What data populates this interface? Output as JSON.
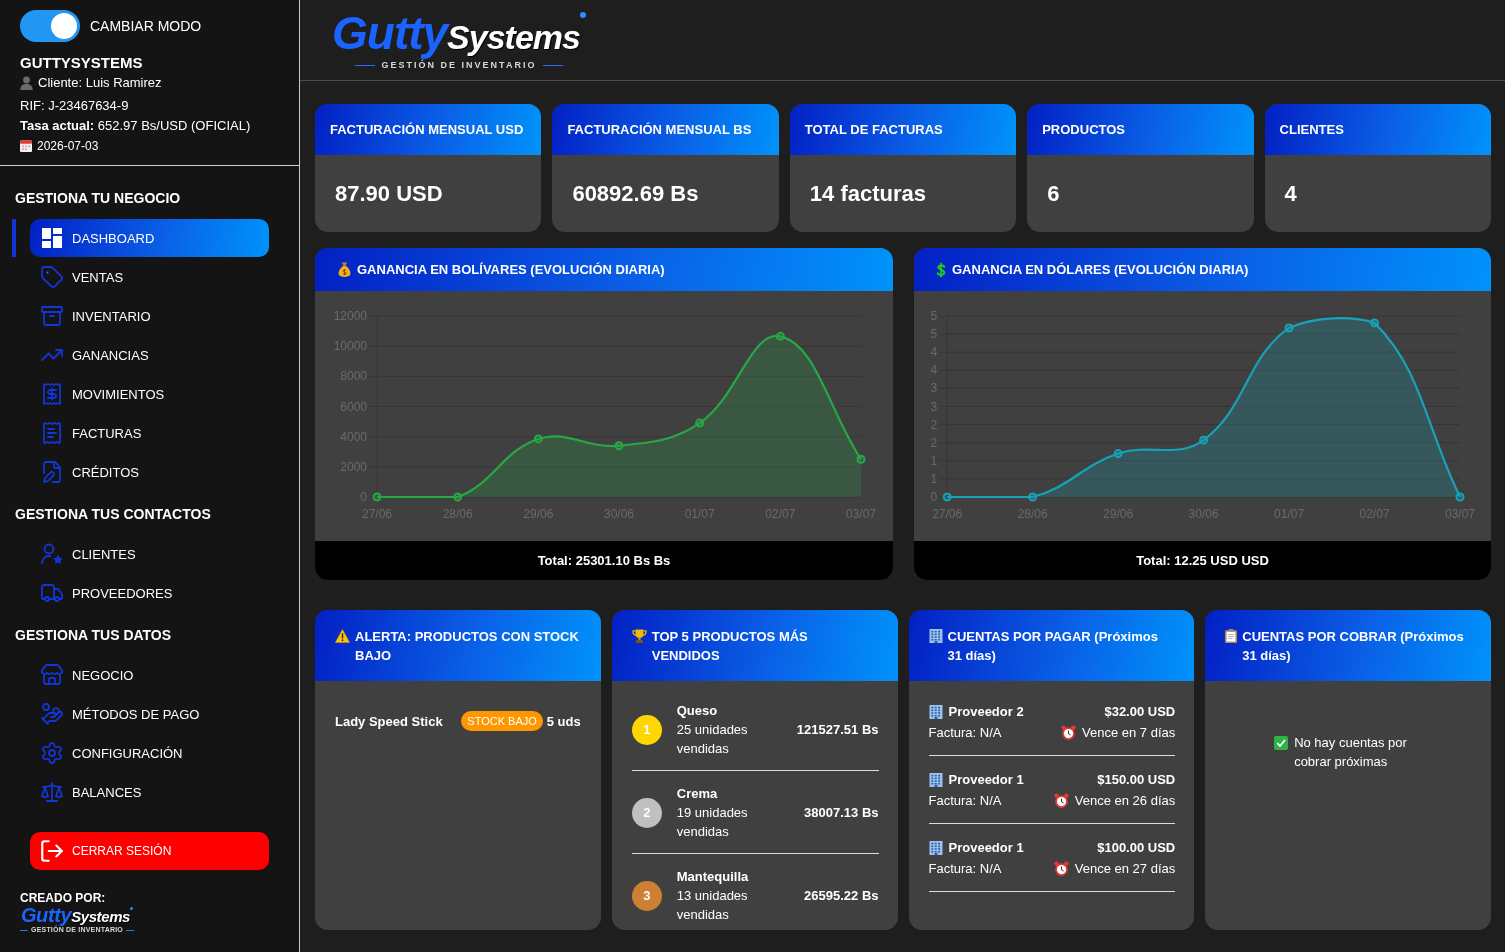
{
  "sidebar": {
    "mode_toggle": {
      "label": "CAMBIAR MODO",
      "on": true
    },
    "company": {
      "name": "GUTTYSYSTEMS",
      "client": "Cliente: Luis Ramirez",
      "rif": "RIF: J-23467634-9",
      "rate": "**Tasa actual:** 652.97 Bs/USD (OFICIAL)",
      "date": "2026-07-03"
    },
    "sections": [
      {
        "title": "GESTIONA TU NEGOCIO",
        "items": [
          {
            "label": "DASHBOARD",
            "selected": true
          },
          {
            "label": "VENTAS",
            "selected": false
          },
          {
            "label": "INVENTARIO",
            "selected": false
          },
          {
            "label": "GANANCIAS",
            "selected": false
          },
          {
            "label": "MOVIMIENTOS",
            "selected": false
          },
          {
            "label": "FACTURAS",
            "selected": false
          },
          {
            "label": "CRÉDITOS",
            "selected": false
          }
        ]
      },
      {
        "title": "GESTIONA TUS CONTACTOS",
        "items": [
          {
            "label": "CLIENTES",
            "selected": false
          },
          {
            "label": "PROVEEDORES",
            "selected": false
          }
        ]
      },
      {
        "title": "GESTIONA TUS DATOS",
        "items": [
          {
            "label": "NEGOCIO",
            "selected": false
          },
          {
            "label": "MÉTODOS DE PAGO",
            "selected": false
          },
          {
            "label": "CONFIGURACIÓN",
            "selected": false
          },
          {
            "label": "BALANCES",
            "selected": false
          }
        ]
      }
    ],
    "logout_button": "CERRAR SESIÓN",
    "footer": {
      "label": "CREADO POR:",
      "logo": {
        "name_parts": [
          "Gutty",
          "Systems"
        ],
        "tagline": "GESTIÓN DE INVENTARIO"
      }
    }
  },
  "header": {
    "logo": {
      "name_parts": [
        "Gutty",
        "Systems"
      ],
      "tagline": "GESTIÓN DE INVENTARIO"
    }
  },
  "stat_cards": [
    {
      "label": "FACTURACIÓN MENSUAL USD",
      "value": "87.90 USD"
    },
    {
      "label": "FACTURACIÓN MENSUAL BS",
      "value": "60892.69 Bs"
    },
    {
      "label": "TOTAL DE FACTURAS",
      "value": "14 facturas"
    },
    {
      "label": "PRODUCTOS",
      "value": "6"
    },
    {
      "label": "CLIENTES",
      "value": "4"
    }
  ],
  "chart_cards": [
    {
      "chart_data": {
        "type": "area",
        "title": "GANANCIA EN BOLÍVARES (EVOLUCIÓN DIARIA)",
        "categories": [
          "27/06",
          "28/06",
          "29/06",
          "30/06",
          "01/07",
          "02/07",
          "03/07"
        ],
        "series": [
          {
            "color": "#28a745",
            "values": [
              0,
              0,
              3850,
              3400,
              4900,
              10650,
              2500
            ]
          }
        ],
        "ylim": [
          0,
          12000
        ],
        "yticks": [
          0,
          2000,
          4000,
          6000,
          8000,
          10000,
          12000
        ],
        "grid": true
      },
      "total": "Total: 25301.10 Bs Bs"
    },
    {
      "chart_data": {
        "type": "area",
        "title": "GANANCIA EN DÓLARES (EVOLUCIÓN DIARIA)",
        "categories": [
          "27/06",
          "28/06",
          "29/06",
          "30/06",
          "01/07",
          "02/07",
          "03/07"
        ],
        "series": [
          {
            "color": "#17a2b8",
            "values": [
              0,
              0,
              1.2,
              1.57,
              4.67,
              4.81,
              0
            ]
          }
        ],
        "ylim": [
          0,
          5
        ],
        "yticks": [
          {
            "value": 0,
            "label": "0"
          },
          {
            "value": 0.5,
            "label": "1"
          },
          {
            "value": 1,
            "label": "1"
          },
          {
            "value": 1.5,
            "label": "2"
          },
          {
            "value": 2,
            "label": "2"
          },
          {
            "value": 2.5,
            "label": "3"
          },
          {
            "value": 3,
            "label": "3"
          },
          {
            "value": 3.5,
            "label": "4"
          },
          {
            "value": 4,
            "label": "4"
          },
          {
            "value": 4.5,
            "label": "5"
          },
          {
            "value": 5,
            "label": "5"
          }
        ],
        "grid": true
      },
      "total": "Total: 12.25 USD USD"
    }
  ],
  "stock_alert_card": {
    "title": "ALERTA: PRODUCTOS CON STOCK BAJO",
    "items": [
      {
        "name": "Lady Speed Stick",
        "status": "STOCK BAJO",
        "quantity": "5 uds"
      }
    ]
  },
  "top_products_card": {
    "title": "TOP 5 PRODUCTOS MÁS VENDIDOS",
    "items": [
      {
        "rank": "1",
        "color": "#ffd700",
        "name": "Queso",
        "units": "25 unidades vendidas",
        "amount": "121527.51 Bs"
      },
      {
        "rank": "2",
        "color": "#c0c0c0",
        "name": "Crema",
        "units": "19 unidades vendidas",
        "amount": "38007.13 Bs"
      },
      {
        "rank": "3",
        "color": "#cd7f32",
        "name": "Mantequilla",
        "units": "13 unidades vendidas",
        "amount": "26595.22 Bs"
      }
    ]
  },
  "payables_card": {
    "title": "CUENTAS POR PAGAR (Próximos 31 días)",
    "items": [
      {
        "supplier": "Proveedor 2",
        "invoice": "Factura: N/A",
        "amount": "$32.00 USD",
        "due": "Vence en 7 días"
      },
      {
        "supplier": "Proveedor 1",
        "invoice": "Factura: N/A",
        "amount": "$150.00 USD",
        "due": "Vence en 26 días"
      },
      {
        "supplier": "Proveedor 1",
        "invoice": "Factura: N/A",
        "amount": "$100.00 USD",
        "due": "Vence en 27 días"
      }
    ]
  },
  "receivables_card": {
    "title": "CUENTAS POR COBRAR (Próximos 31 días)",
    "empty_message": "No hay cuentas por cobrar próximas"
  }
}
